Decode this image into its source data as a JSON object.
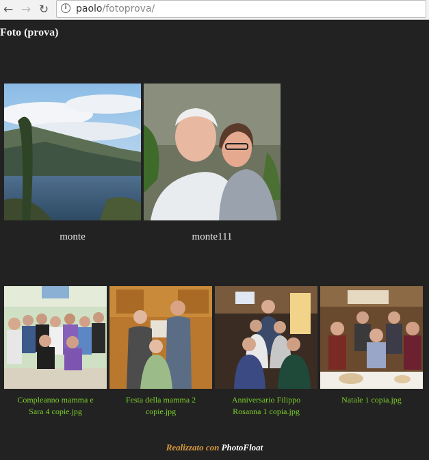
{
  "browser": {
    "url_host": "paolo",
    "url_path": "/fotoprova/"
  },
  "page": {
    "title": "Foto (prova)"
  },
  "albums": [
    {
      "caption": "monte",
      "thumb": "lake-mountain-landscape"
    },
    {
      "caption": "monte111",
      "thumb": "elderly-man-and-woman-portrait"
    }
  ],
  "photos": [
    {
      "line1": "Compleanno mamma e",
      "line2": "Sara 4 copie.jpg",
      "thumb": "family-group-birthday"
    },
    {
      "line1": "Festa della mamma 2",
      "line2": "copie.jpg",
      "thumb": "kitchen-family-portrait"
    },
    {
      "line1": "Anniversario Filippo",
      "line2": "Rosanna 1 copia.jpg",
      "thumb": "anniversary-group"
    },
    {
      "line1": "Natale 1 copia.jpg",
      "line2": "",
      "thumb": "christmas-dinner-table"
    }
  ],
  "footer": {
    "prefix": "Realizzato con",
    "brand": "PhotoFloat"
  },
  "colors": {
    "background": "#222222",
    "caption_link": "#7ccf29",
    "footer_prefix": "#d99a3c"
  }
}
